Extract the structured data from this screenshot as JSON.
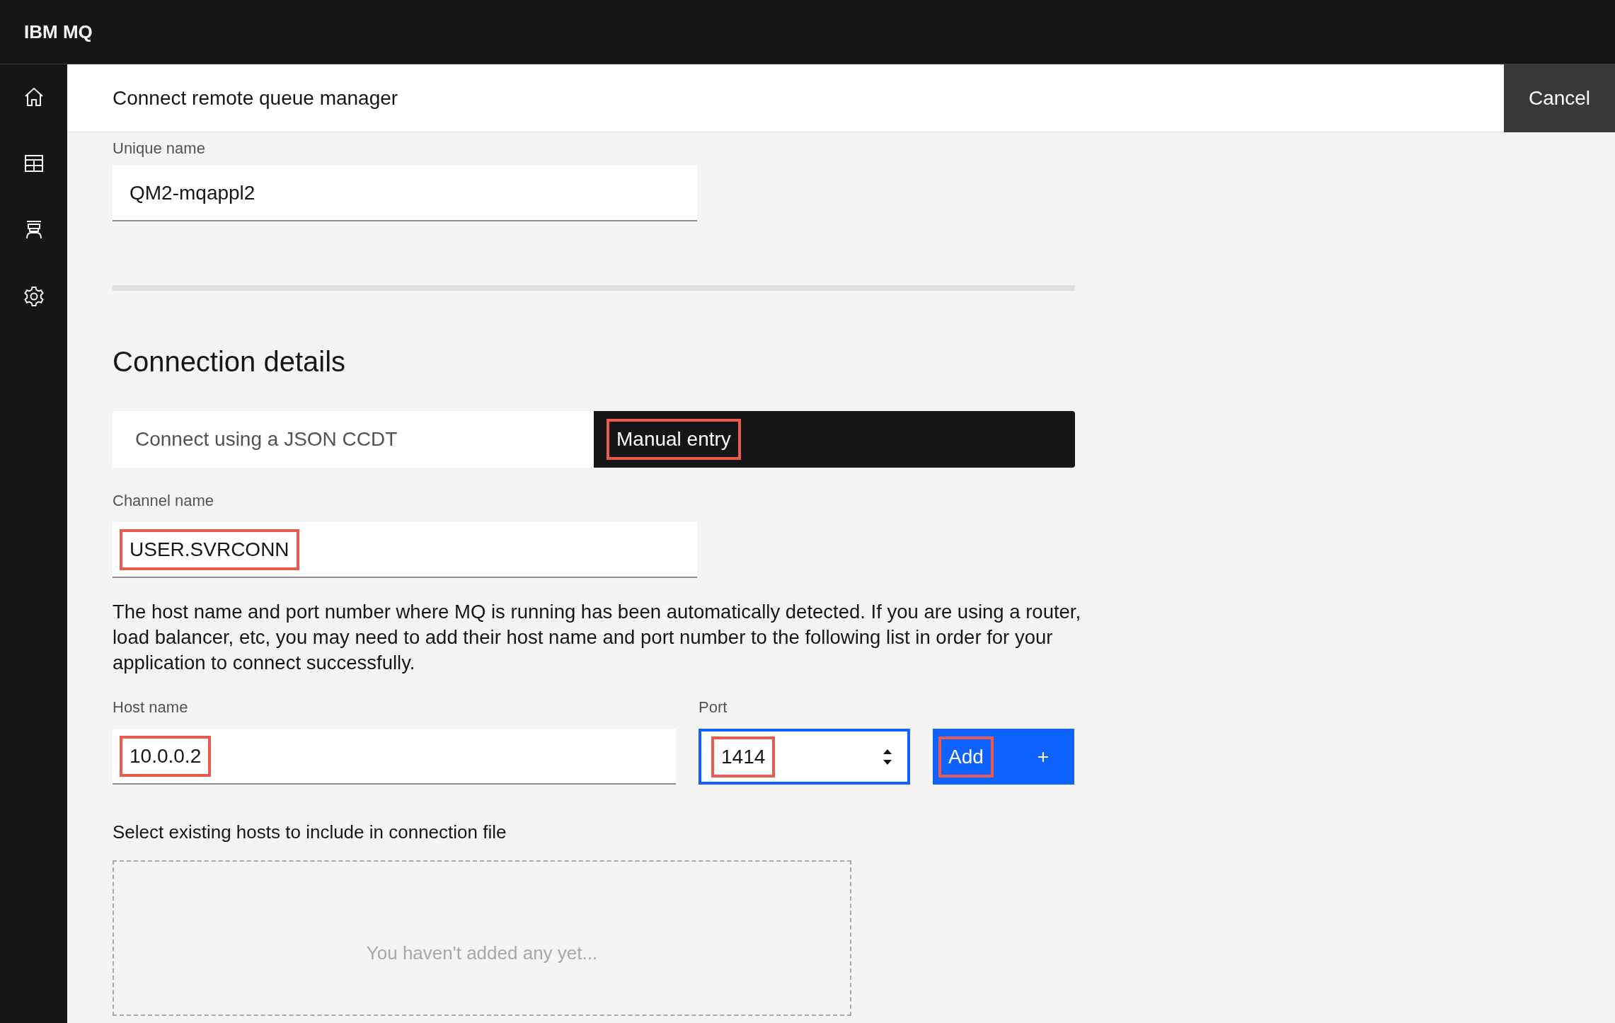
{
  "app": {
    "title": "IBM MQ"
  },
  "panel": {
    "title": "Connect remote queue manager",
    "cancel": "Cancel"
  },
  "unique_name": {
    "label": "Unique name",
    "value": "QM2-mqappl2"
  },
  "section": {
    "title": "Connection details"
  },
  "tabs": [
    {
      "label": "Connect using a JSON CCDT",
      "selected": false,
      "highlighted": false
    },
    {
      "label": "Manual entry",
      "selected": true,
      "highlighted": true
    }
  ],
  "channel": {
    "label": "Channel name",
    "value": "USER.SVRCONN",
    "highlighted": true
  },
  "description": "The host name and port number where MQ is running has been automatically detected. If you are using a router, load balancer, etc, you may need to add their host name and port number to the following list in order for your application to connect successfully.",
  "host": {
    "label": "Host name",
    "value": "10.0.0.2",
    "highlighted": true
  },
  "port": {
    "label": "Port",
    "value": "1414",
    "highlighted": true,
    "focused": true
  },
  "add_button": {
    "label": "Add",
    "icon": "+",
    "highlighted": true
  },
  "hosts_list": {
    "label": "Select existing hosts to include in connection file",
    "empty_text": "You haven't added any yet..."
  }
}
